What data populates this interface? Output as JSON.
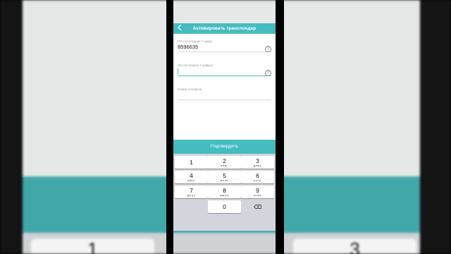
{
  "header": {
    "title": "Активировать транспондер"
  },
  "form": {
    "pan": {
      "label": "PAN (последние 7 цифр)",
      "value": "8596635"
    },
    "sn": {
      "label": "SN (последние 4 цифры)",
      "value": ""
    },
    "phone": {
      "label": "Номер телефона",
      "value": ""
    },
    "help_icon": "?"
  },
  "submit_label": "Подтвердить",
  "keypad": {
    "keys": [
      {
        "num": "1",
        "letters": ""
      },
      {
        "num": "2",
        "letters": "абвг"
      },
      {
        "num": "3",
        "letters": "дежз"
      },
      {
        "num": "4",
        "letters": "ийкл"
      },
      {
        "num": "5",
        "letters": "мноп"
      },
      {
        "num": "6",
        "letters": "рсту"
      },
      {
        "num": "7",
        "letters": "фхцч"
      },
      {
        "num": "8",
        "letters": "шщъы"
      },
      {
        "num": "9",
        "letters": "ьэюя"
      },
      {
        "num": "0",
        "letters": ""
      }
    ]
  },
  "background": {
    "left_key": "1",
    "right_key": "3"
  },
  "colors": {
    "accent": "#45bcc0",
    "background_teal": "#42a7a9",
    "keypad_bg": "#d2d5db"
  },
  "icons": {
    "back": "chevron-left-icon",
    "help": "question-circle-icon",
    "delete": "backspace-icon"
  }
}
